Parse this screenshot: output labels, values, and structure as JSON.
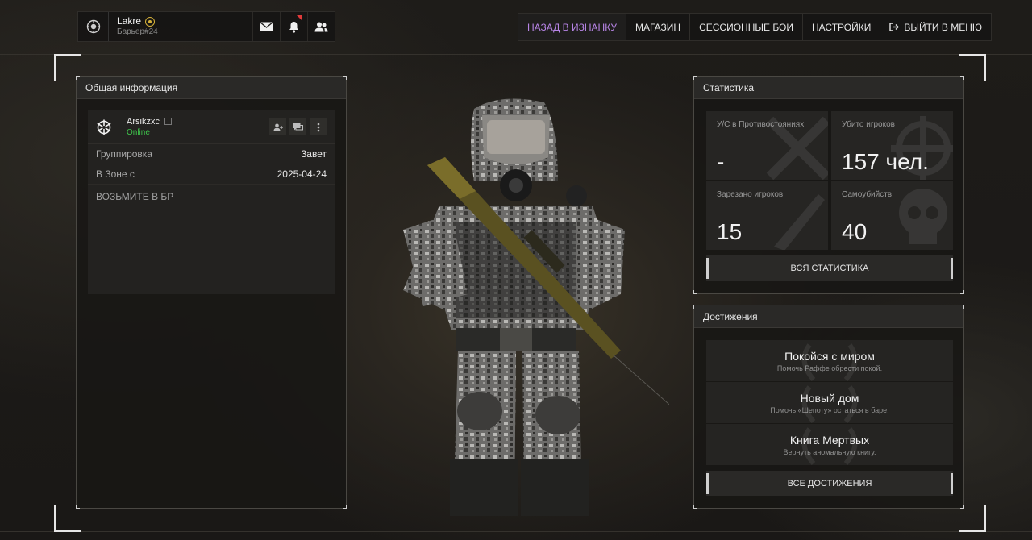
{
  "player": {
    "name": "Lakre",
    "tag": "Барьер#24"
  },
  "nav": {
    "items": [
      {
        "label": "НАЗАД В ИЗНАНКУ",
        "active": true
      },
      {
        "label": "МАГАЗИН"
      },
      {
        "label": "СЕССИОННЫЕ БОИ"
      },
      {
        "label": "НАСТРОЙКИ"
      },
      {
        "label": "ВЫЙТИ В МЕНЮ",
        "icon": "exit-icon"
      }
    ]
  },
  "general_info": {
    "title": "Общая информация",
    "user_name": "Arsikzxc",
    "status": "Online",
    "rows": [
      {
        "key": "Группировка",
        "value": "Завет"
      },
      {
        "key": "В Зоне с",
        "value": "2025-04-24"
      }
    ],
    "note": "ВОЗЬМИТЕ В БР"
  },
  "stats": {
    "title": "Статистика",
    "cells": [
      {
        "label": "У/С в Противостояниях",
        "value": "-"
      },
      {
        "label": "Убито игроков",
        "value": "157 чел."
      },
      {
        "label": "Зарезано игроков",
        "value": "15"
      },
      {
        "label": "Самоубийств",
        "value": "40"
      }
    ],
    "all_button": "ВСЯ СТАТИСТИКА"
  },
  "achievements": {
    "title": "Достижения",
    "items": [
      {
        "title": "Покойся с миром",
        "desc": "Помочь Раффе обрести покой."
      },
      {
        "title": "Новый дом",
        "desc": "Помочь «Шепоту» остаться в баре."
      },
      {
        "title": "Книга Мертвых",
        "desc": "Вернуть аномальную книгу."
      }
    ],
    "all_button": "ВСЕ ДОСТИЖЕНИЯ"
  },
  "colors": {
    "accent": "#b784e6",
    "online": "#3ec24a",
    "notification": "#e03a3a",
    "badge": "#d7b23a"
  }
}
